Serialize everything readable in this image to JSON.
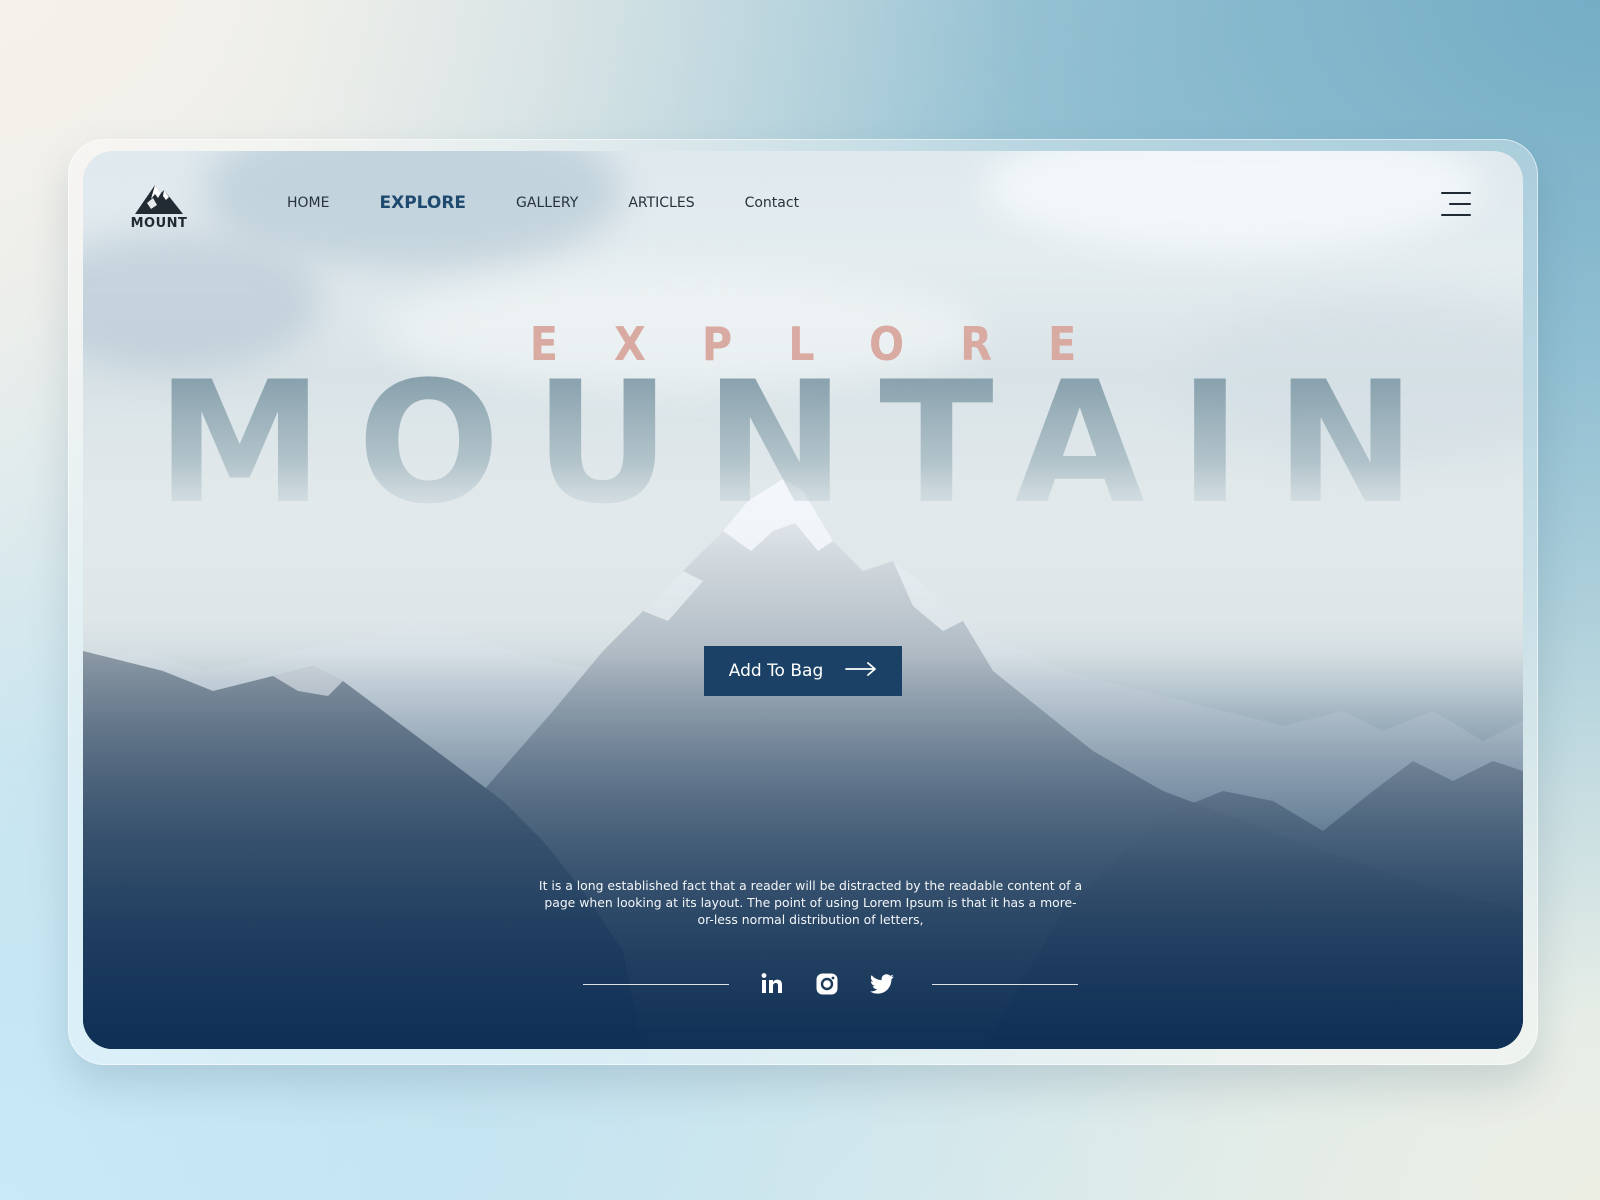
{
  "brand": {
    "name": "MOUNT",
    "logo_icon": "mountain-peak-icon"
  },
  "nav": {
    "items": [
      {
        "label": "HOME",
        "active": false
      },
      {
        "label": "EXPLORE",
        "active": true
      },
      {
        "label": "GALLERY",
        "active": false
      },
      {
        "label": "ARTICLES",
        "active": false
      },
      {
        "label": "Contact",
        "active": false
      }
    ],
    "menu_icon": "hamburger-menu-icon"
  },
  "hero": {
    "kicker": "EXPLORE",
    "headline": "MOUNTAIN",
    "cta_label": "Add To Bag",
    "cta_icon": "arrow-right-icon",
    "description": "It is a long established fact that a reader will be distracted by the readable content of a page when looking at its layout. The point of using Lorem Ipsum is that it has a more-or-less normal distribution of letters,"
  },
  "social": [
    {
      "name": "linkedin-icon"
    },
    {
      "name": "instagram-icon"
    },
    {
      "name": "twitter-icon"
    }
  ],
  "colors": {
    "accent_navy": "#1b4266",
    "kicker_pink": "#d8aaa2",
    "nav_active": "#1e4a6f"
  }
}
